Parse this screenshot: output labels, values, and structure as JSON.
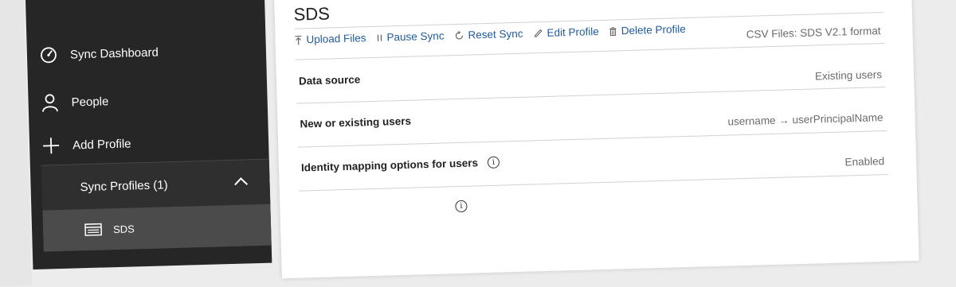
{
  "sidebar": {
    "items": [
      {
        "label": "Sync Dashboard",
        "icon": "dashboard-icon"
      },
      {
        "label": "People",
        "icon": "person-icon"
      },
      {
        "label": "Add Profile",
        "icon": "plus-icon"
      }
    ],
    "sync_profiles": {
      "label": "Sync Profiles (1)",
      "expanded": true
    },
    "profiles": [
      {
        "label": "SDS",
        "icon": "profile-table-icon"
      }
    ]
  },
  "main": {
    "title": "SDS",
    "toolbar": [
      {
        "label": "Upload Files",
        "icon": "upload-icon"
      },
      {
        "label": "Pause Sync",
        "icon": "pause-icon"
      },
      {
        "label": "Reset Sync",
        "icon": "reset-icon"
      },
      {
        "label": "Edit Profile",
        "icon": "pencil-icon"
      },
      {
        "label": "Delete Profile",
        "icon": "trash-icon"
      }
    ],
    "details": [
      {
        "label": "Data source",
        "value": "CSV Files: SDS V2.1 format"
      },
      {
        "label": "New or existing users",
        "value": "Existing users"
      },
      {
        "label": "Identity mapping options for users",
        "value": "username → userPrincipalName",
        "info": true
      },
      {
        "label": "",
        "value": "Enabled",
        "info": true
      }
    ]
  },
  "colors": {
    "sidebar_bg": "#262626",
    "sync_profiles_bg": "#2f2f2f",
    "selected_profile_bg": "#4b4b4b",
    "link": "#1f5a9e",
    "muted_text": "#6b6b6b"
  }
}
